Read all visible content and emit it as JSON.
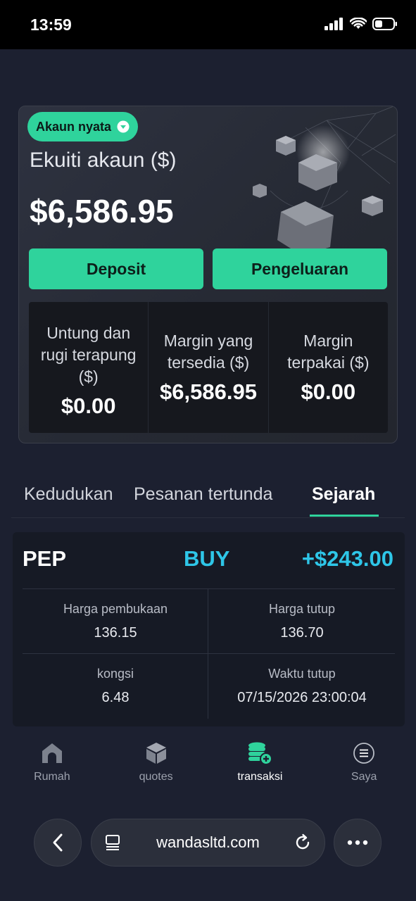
{
  "status_bar": {
    "time": "13:59"
  },
  "account": {
    "type_label": "Akaun nyata",
    "equity_label": "Ekuiti akaun ($)",
    "equity_value": "$6,586.95",
    "deposit_label": "Deposit",
    "withdraw_label": "Pengeluaran",
    "stats": [
      {
        "label": "Untung dan rugi terapung ($)",
        "value": "$0.00"
      },
      {
        "label": "Margin yang tersedia ($)",
        "value": "$6,586.95"
      },
      {
        "label": "Margin terpakai ($)",
        "value": "$0.00"
      }
    ]
  },
  "tabs": [
    {
      "label": "Kedudukan",
      "active": false
    },
    {
      "label": "Pesanan tertunda",
      "active": false
    },
    {
      "label": "Sejarah",
      "active": true
    }
  ],
  "trade": {
    "symbol": "PEP",
    "side": "BUY",
    "pnl": "+$243.00",
    "fields": [
      {
        "label": "Harga pembukaan",
        "value": "136.15"
      },
      {
        "label": "Harga tutup",
        "value": "136.70"
      },
      {
        "label": "kongsi",
        "value": "6.48"
      },
      {
        "label": "Waktu tutup",
        "value": "07/15/2026 23:00:04"
      }
    ]
  },
  "bottom_nav": [
    {
      "label": "Rumah",
      "icon": "home-icon",
      "active": false
    },
    {
      "label": "quotes",
      "icon": "cube-icon",
      "active": false
    },
    {
      "label": "transaksi",
      "icon": "coins-add-icon",
      "active": true
    },
    {
      "label": "Saya",
      "icon": "menu-circle-icon",
      "active": false
    }
  ],
  "browser": {
    "url": "wandasltd.com"
  },
  "colors": {
    "accent": "#2fd39c",
    "buy": "#2ec6e8",
    "background": "#1c2030"
  }
}
